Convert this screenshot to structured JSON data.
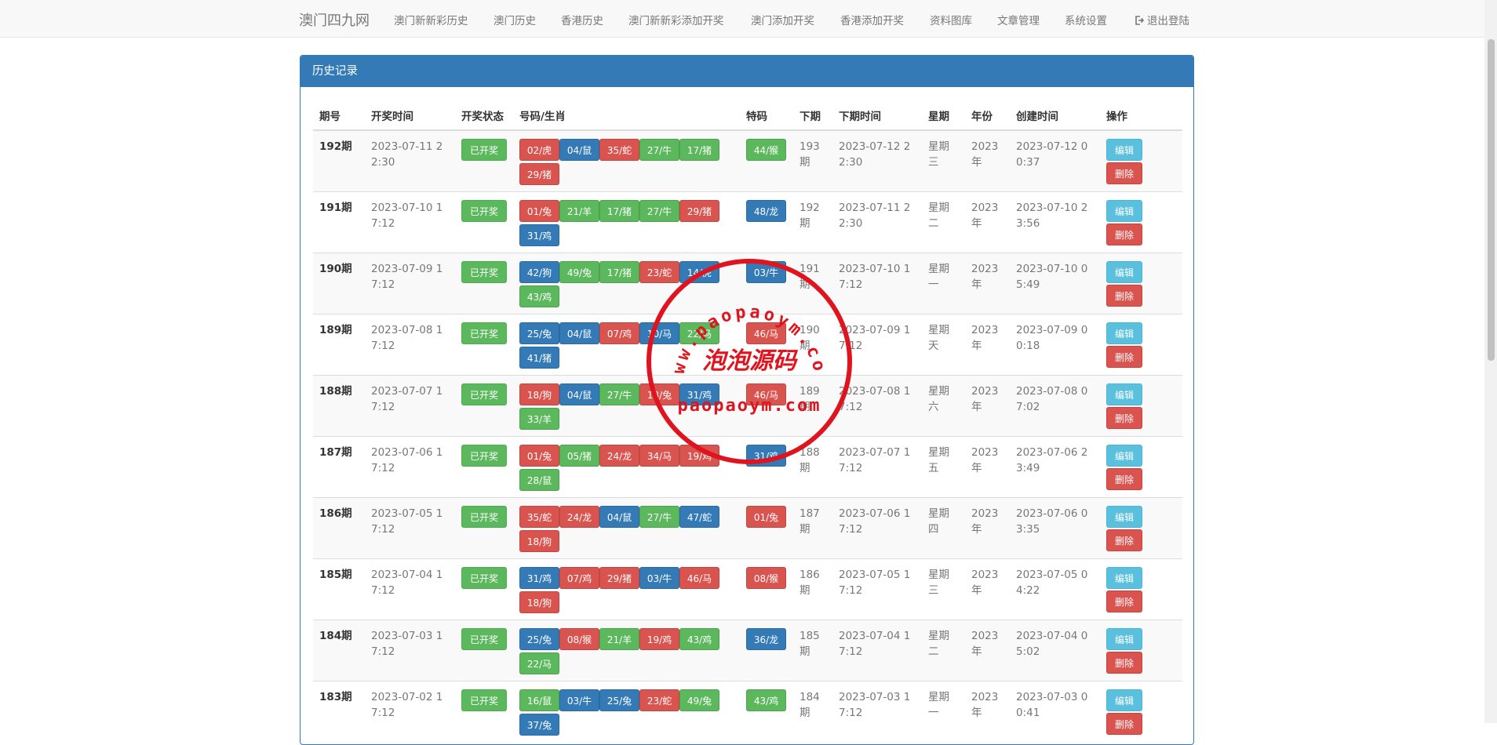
{
  "navbar": {
    "brand": "澳门四九网",
    "items": [
      "澳门新新彩历史",
      "澳门历史",
      "香港历史",
      "澳门新新彩添加开奖",
      "澳门添加开奖",
      "香港添加开奖",
      "资料图库",
      "文章管理",
      "系统设置"
    ],
    "logout": "退出登陆",
    "logout_icon": "logout-icon"
  },
  "panel": {
    "title": "历史记录",
    "columns": [
      "期号",
      "开奖时间",
      "开奖状态",
      "号码/生肖",
      "特码",
      "下期",
      "下期时间",
      "星期",
      "年份",
      "创建时间",
      "操作"
    ],
    "edit_label": "编辑",
    "delete_label": "删除",
    "rows": [
      {
        "period": "192期",
        "draw_time": "2023-07-11 22:30",
        "status": "已开奖",
        "numbers": [
          {
            "t": "02/虎",
            "c": "red"
          },
          {
            "t": "04/鼠",
            "c": "blue"
          },
          {
            "t": "35/蛇",
            "c": "red"
          },
          {
            "t": "27/牛",
            "c": "green"
          },
          {
            "t": "17/猪",
            "c": "green"
          },
          {
            "t": "29/猪",
            "c": "red"
          }
        ],
        "special": {
          "t": "44/猴",
          "c": "green"
        },
        "next": "193期",
        "next_time": "2023-07-12 22:30",
        "weekday": "星期三",
        "year": "2023年",
        "created": "2023-07-12 00:37"
      },
      {
        "period": "191期",
        "draw_time": "2023-07-10 17:12",
        "status": "已开奖",
        "numbers": [
          {
            "t": "01/兔",
            "c": "red"
          },
          {
            "t": "21/羊",
            "c": "green"
          },
          {
            "t": "17/猪",
            "c": "green"
          },
          {
            "t": "27/牛",
            "c": "green"
          },
          {
            "t": "29/猪",
            "c": "red"
          },
          {
            "t": "31/鸡",
            "c": "blue"
          }
        ],
        "special": {
          "t": "48/龙",
          "c": "blue"
        },
        "next": "192期",
        "next_time": "2023-07-11 22:30",
        "weekday": "星期二",
        "year": "2023年",
        "created": "2023-07-10 23:56"
      },
      {
        "period": "190期",
        "draw_time": "2023-07-09 17:12",
        "status": "已开奖",
        "numbers": [
          {
            "t": "42/狗",
            "c": "blue"
          },
          {
            "t": "49/兔",
            "c": "green"
          },
          {
            "t": "17/猪",
            "c": "green"
          },
          {
            "t": "23/蛇",
            "c": "red"
          },
          {
            "t": "14/虎",
            "c": "blue"
          },
          {
            "t": "43/鸡",
            "c": "green"
          }
        ],
        "special": {
          "t": "03/牛",
          "c": "blue"
        },
        "next": "191期",
        "next_time": "2023-07-10 17:12",
        "weekday": "星期一",
        "year": "2023年",
        "created": "2023-07-10 05:49"
      },
      {
        "period": "189期",
        "draw_time": "2023-07-08 17:12",
        "status": "已开奖",
        "numbers": [
          {
            "t": "25/兔",
            "c": "blue"
          },
          {
            "t": "04/鼠",
            "c": "blue"
          },
          {
            "t": "07/鸡",
            "c": "red"
          },
          {
            "t": "10/马",
            "c": "blue"
          },
          {
            "t": "22/马",
            "c": "green"
          },
          {
            "t": "41/猪",
            "c": "blue"
          }
        ],
        "special": {
          "t": "46/马",
          "c": "red"
        },
        "next": "190期",
        "next_time": "2023-07-09 17:12",
        "weekday": "星期天",
        "year": "2023年",
        "created": "2023-07-09 00:18"
      },
      {
        "period": "188期",
        "draw_time": "2023-07-07 17:12",
        "status": "已开奖",
        "numbers": [
          {
            "t": "18/狗",
            "c": "red"
          },
          {
            "t": "04/鼠",
            "c": "blue"
          },
          {
            "t": "27/牛",
            "c": "green"
          },
          {
            "t": "13/兔",
            "c": "red"
          },
          {
            "t": "31/鸡",
            "c": "blue"
          },
          {
            "t": "33/羊",
            "c": "green"
          }
        ],
        "special": {
          "t": "46/马",
          "c": "red"
        },
        "next": "189期",
        "next_time": "2023-07-08 17:12",
        "weekday": "星期六",
        "year": "2023年",
        "created": "2023-07-08 07:02"
      },
      {
        "period": "187期",
        "draw_time": "2023-07-06 17:12",
        "status": "已开奖",
        "numbers": [
          {
            "t": "01/兔",
            "c": "red"
          },
          {
            "t": "05/猪",
            "c": "green"
          },
          {
            "t": "24/龙",
            "c": "red"
          },
          {
            "t": "34/马",
            "c": "red"
          },
          {
            "t": "19/鸡",
            "c": "red"
          },
          {
            "t": "28/鼠",
            "c": "green"
          }
        ],
        "special": {
          "t": "31/鸡",
          "c": "blue"
        },
        "next": "188期",
        "next_time": "2023-07-07 17:12",
        "weekday": "星期五",
        "year": "2023年",
        "created": "2023-07-06 23:49"
      },
      {
        "period": "186期",
        "draw_time": "2023-07-05 17:12",
        "status": "已开奖",
        "numbers": [
          {
            "t": "35/蛇",
            "c": "red"
          },
          {
            "t": "24/龙",
            "c": "red"
          },
          {
            "t": "04/鼠",
            "c": "blue"
          },
          {
            "t": "27/牛",
            "c": "green"
          },
          {
            "t": "47/蛇",
            "c": "blue"
          },
          {
            "t": "18/狗",
            "c": "red"
          }
        ],
        "special": {
          "t": "01/兔",
          "c": "red"
        },
        "next": "187期",
        "next_time": "2023-07-06 17:12",
        "weekday": "星期四",
        "year": "2023年",
        "created": "2023-07-06 03:35"
      },
      {
        "period": "185期",
        "draw_time": "2023-07-04 17:12",
        "status": "已开奖",
        "numbers": [
          {
            "t": "31/鸡",
            "c": "blue"
          },
          {
            "t": "07/鸡",
            "c": "red"
          },
          {
            "t": "29/猪",
            "c": "red"
          },
          {
            "t": "03/牛",
            "c": "blue"
          },
          {
            "t": "46/马",
            "c": "red"
          },
          {
            "t": "18/狗",
            "c": "red"
          }
        ],
        "special": {
          "t": "08/猴",
          "c": "red"
        },
        "next": "186期",
        "next_time": "2023-07-05 17:12",
        "weekday": "星期三",
        "year": "2023年",
        "created": "2023-07-05 04:22"
      },
      {
        "period": "184期",
        "draw_time": "2023-07-03 17:12",
        "status": "已开奖",
        "numbers": [
          {
            "t": "25/兔",
            "c": "blue"
          },
          {
            "t": "08/猴",
            "c": "red"
          },
          {
            "t": "21/羊",
            "c": "green"
          },
          {
            "t": "19/鸡",
            "c": "red"
          },
          {
            "t": "43/鸡",
            "c": "green"
          },
          {
            "t": "22/马",
            "c": "green"
          }
        ],
        "special": {
          "t": "36/龙",
          "c": "blue"
        },
        "next": "185期",
        "next_time": "2023-07-04 17:12",
        "weekday": "星期二",
        "year": "2023年",
        "created": "2023-07-04 05:02"
      },
      {
        "period": "183期",
        "draw_time": "2023-07-02 17:12",
        "status": "已开奖",
        "numbers": [
          {
            "t": "16/鼠",
            "c": "green"
          },
          {
            "t": "03/牛",
            "c": "blue"
          },
          {
            "t": "25/兔",
            "c": "blue"
          },
          {
            "t": "23/蛇",
            "c": "red"
          },
          {
            "t": "49/兔",
            "c": "green"
          },
          {
            "t": "37/兔",
            "c": "blue"
          }
        ],
        "special": {
          "t": "43/鸡",
          "c": "green"
        },
        "next": "184期",
        "next_time": "2023-07-03 17:12",
        "weekday": "星期一",
        "year": "2023年",
        "created": "2023-07-03 00:41"
      }
    ]
  },
  "watermark": {
    "url_text": "www.paopaoym.com",
    "name_text": "泡泡源码",
    "domain_text": "paopaoym.com",
    "color": "#e0141e"
  }
}
